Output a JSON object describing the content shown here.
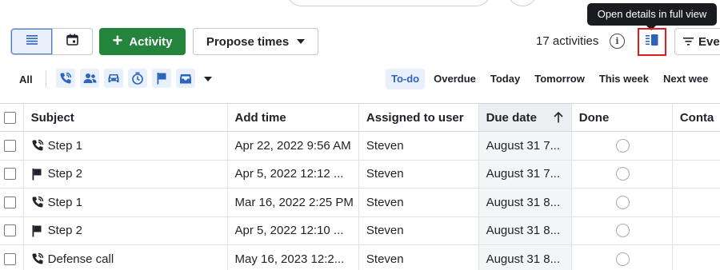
{
  "tooltip": "Open details in full view",
  "toolbar": {
    "activity_label": "Activity",
    "propose_label": "Propose times",
    "count_label": "17 activities",
    "events_label": "Eve"
  },
  "filters": {
    "all_label": "All",
    "type_icons": [
      "phone-icon",
      "meeting-icon",
      "car-icon",
      "deadline-icon",
      "flag-icon",
      "email-icon"
    ],
    "due_tabs": [
      "To-do",
      "Overdue",
      "Today",
      "Tomorrow",
      "This week",
      "Next wee"
    ],
    "active_due_tab": "To-do"
  },
  "table": {
    "columns": [
      "Subject",
      "Add time",
      "Assigned to user",
      "Due date",
      "Done",
      "Conta"
    ],
    "sorted_column": "Due date",
    "rows": [
      {
        "icon": "phone-icon",
        "subject": "Step 1",
        "add_time": "Apr 22, 2022 9:56 AM",
        "assigned": "Steven",
        "due": "August 31 7..."
      },
      {
        "icon": "flag-icon",
        "subject": "Step 2",
        "add_time": "Apr 5, 2022 12:12 ...",
        "assigned": "Steven",
        "due": "August 31 7..."
      },
      {
        "icon": "phone-icon",
        "subject": "Step 1",
        "add_time": "Mar 16, 2022 2:25 PM",
        "assigned": "Steven",
        "due": "August 31 8..."
      },
      {
        "icon": "flag-icon",
        "subject": "Step 2",
        "add_time": "Apr 5, 2022 12:10 ...",
        "assigned": "Steven",
        "due": "August 31 8..."
      },
      {
        "icon": "phone-icon",
        "subject": "Defense call",
        "add_time": "May 16, 2023 12:2...",
        "assigned": "Steven",
        "due": "August 31 8..."
      }
    ]
  },
  "colors": {
    "accent_blue": "#2c63bd",
    "primary_green": "#24843b",
    "highlight_red": "#e01b1b"
  }
}
